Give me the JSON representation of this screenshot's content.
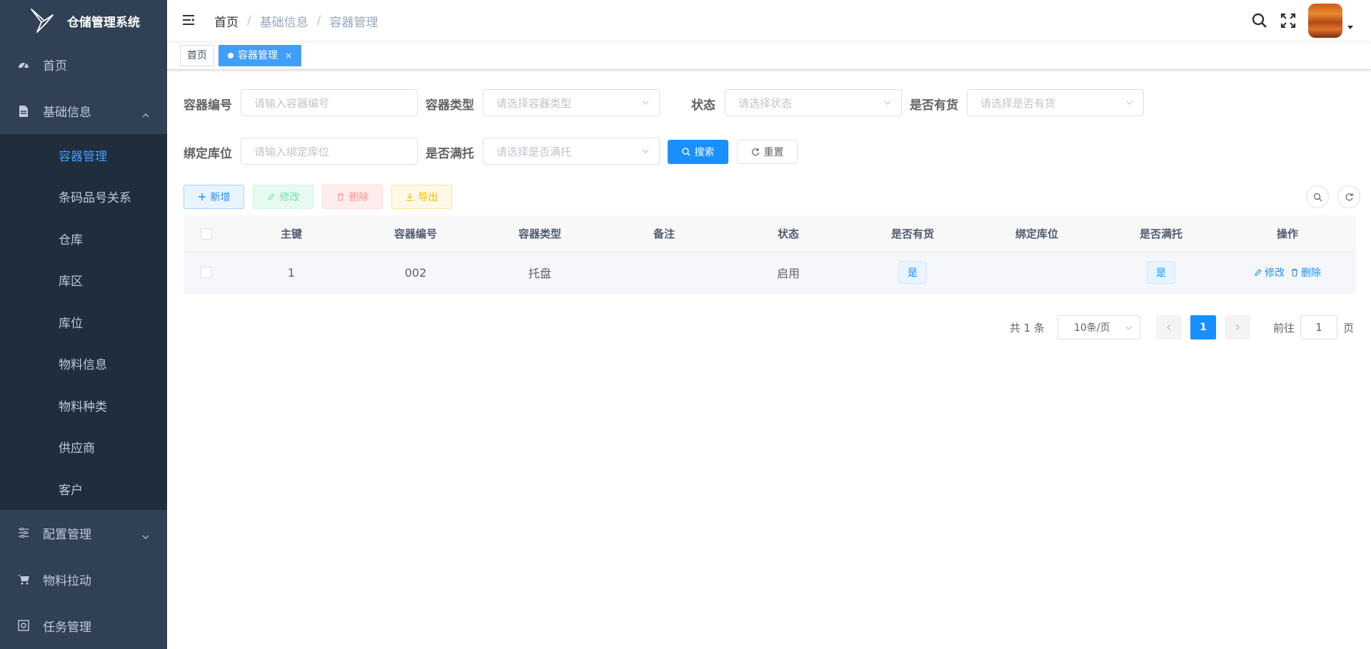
{
  "app": {
    "title": "仓储管理系统"
  },
  "sidebar": {
    "items": [
      {
        "label": "首页",
        "icon": "dashboard-icon"
      },
      {
        "label": "基础信息",
        "icon": "document-icon",
        "expanded": true,
        "children": [
          "容器管理",
          "条码品号关系",
          "仓库",
          "库区",
          "库位",
          "物料信息",
          "物料种类",
          "供应商",
          "客户"
        ],
        "active_child": "容器管理"
      },
      {
        "label": "配置管理",
        "icon": "settings-sliders-icon",
        "expanded": false
      },
      {
        "label": "物料拉动",
        "icon": "cart-icon"
      },
      {
        "label": "任务管理",
        "icon": "task-icon"
      }
    ]
  },
  "breadcrumb": [
    "首页",
    "基础信息",
    "容器管理"
  ],
  "tags": {
    "home": "首页",
    "active": "容器管理",
    "close": "×"
  },
  "search": {
    "container_code_label": "容器编号",
    "container_code_placeholder": "请输入容器编号",
    "container_type_label": "容器类型",
    "container_type_placeholder": "请选择容器类型",
    "status_label": "状态",
    "status_placeholder": "请选择状态",
    "has_goods_label": "是否有货",
    "has_goods_placeholder": "请选择是否有货",
    "bind_location_label": "绑定库位",
    "bind_location_placeholder": "请输入绑定库位",
    "full_pallet_label": "是否满托",
    "full_pallet_placeholder": "请选择是否满托",
    "search_button": "搜索",
    "reset_button": "重置"
  },
  "toolbar": {
    "add": "新增",
    "edit": "修改",
    "delete": "删除",
    "export": "导出"
  },
  "table": {
    "columns": [
      "主键",
      "容器编号",
      "容器类型",
      "备注",
      "状态",
      "是否有货",
      "绑定库位",
      "是否满托",
      "操作"
    ],
    "rows": [
      {
        "id": "1",
        "code": "002",
        "type": "托盘",
        "remark": "",
        "status": "启用",
        "has_goods": "是",
        "location": "",
        "full": "是",
        "edit": "修改",
        "delete": "删除"
      }
    ]
  },
  "pagination": {
    "total": "共 1 条",
    "page_size": "10条/页",
    "current": "1",
    "goto_label": "前往",
    "goto_value": "1",
    "page_suffix": "页"
  },
  "colors": {
    "sidebar_bg": "#304156",
    "submenu_bg": "#1f2d3d",
    "accent": "#1890ff",
    "active_menu": "#409eff"
  }
}
